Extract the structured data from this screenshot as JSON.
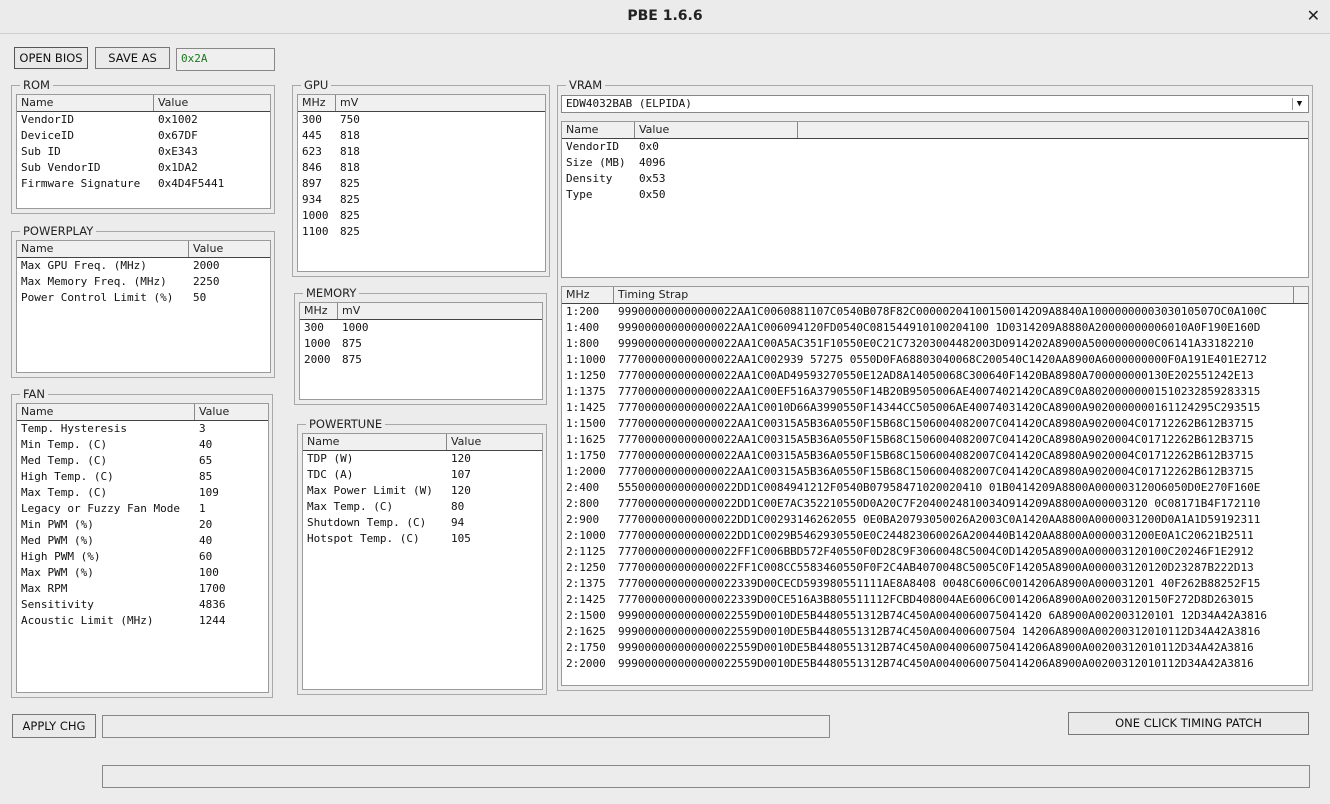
{
  "window": {
    "title": "PBE 1.6.6"
  },
  "toolbar": {
    "open_label": "OPEN BIOS",
    "save_label": "SAVE AS",
    "offset_value": "0x2A"
  },
  "rom": {
    "title": "ROM",
    "headers": [
      "Name",
      "Value"
    ],
    "rows": [
      [
        "VendorID",
        "0x1002"
      ],
      [
        "DeviceID",
        "0x67DF"
      ],
      [
        "Sub ID",
        "0xE343"
      ],
      [
        "Sub VendorID",
        "0x1DA2"
      ],
      [
        "Firmware Signature",
        "0x4D4F5441"
      ]
    ]
  },
  "powerplay": {
    "title": "POWERPLAY",
    "headers": [
      "Name",
      "Value"
    ],
    "rows": [
      [
        "Max GPU Freq. (MHz)",
        "2000"
      ],
      [
        "Max Memory Freq. (MHz)",
        "2250"
      ],
      [
        "Power Control Limit (%)",
        "50"
      ]
    ]
  },
  "fan": {
    "title": "FAN",
    "headers": [
      "Name",
      "Value"
    ],
    "rows": [
      [
        "Temp. Hysteresis",
        "3"
      ],
      [
        "Min Temp. (C)",
        "40"
      ],
      [
        "Med Temp. (C)",
        "65"
      ],
      [
        "High Temp. (C)",
        "85"
      ],
      [
        "Max Temp. (C)",
        "109"
      ],
      [
        "Legacy or Fuzzy Fan Mode",
        "1"
      ],
      [
        "Min PWM (%)",
        "20"
      ],
      [
        "Med PWM (%)",
        "40"
      ],
      [
        "High PWM (%)",
        "60"
      ],
      [
        "Max PWM (%)",
        "100"
      ],
      [
        "Max RPM",
        "1700"
      ],
      [
        "Sensitivity",
        "4836"
      ],
      [
        "Acoustic Limit (MHz)",
        "1244"
      ]
    ]
  },
  "gpu": {
    "title": "GPU",
    "headers": [
      "MHz",
      "mV"
    ],
    "rows": [
      [
        "300",
        "750"
      ],
      [
        "445",
        "818"
      ],
      [
        "623",
        "818"
      ],
      [
        "846",
        "818"
      ],
      [
        "897",
        "825"
      ],
      [
        "934",
        "825"
      ],
      [
        "1000",
        "825"
      ],
      [
        "1100",
        "825"
      ]
    ]
  },
  "memory": {
    "title": "MEMORY",
    "headers": [
      "MHz",
      "mV"
    ],
    "rows": [
      [
        "300",
        "1000"
      ],
      [
        "1000",
        "875"
      ],
      [
        "2000",
        "875"
      ]
    ]
  },
  "powertune": {
    "title": "POWERTUNE",
    "headers": [
      "Name",
      "Value"
    ],
    "rows": [
      [
        "TDP (W)",
        "120"
      ],
      [
        "TDC (A)",
        "107"
      ],
      [
        "Max Power Limit (W)",
        "120"
      ],
      [
        "Max Temp. (C)",
        "80"
      ],
      [
        "Shutdown Temp. (C)",
        "94"
      ],
      [
        "Hotspot Temp. (C)",
        "105"
      ]
    ]
  },
  "vram": {
    "title": "VRAM",
    "selected": "EDW4032BAB (ELPIDA)",
    "headers": [
      "Name",
      "Value",
      ""
    ],
    "rows": [
      [
        "VendorID",
        "0x0"
      ],
      [
        "Size (MB)",
        "4096"
      ],
      [
        "Density",
        "0x53"
      ],
      [
        "Type",
        "0x50"
      ]
    ]
  },
  "timing": {
    "headers": [
      "MHz",
      "Timing Strap"
    ],
    "rows": [
      [
        "1:200",
        "999000000000000022AA1C0060881107C0540B078F82C000002041001500142O9A8840A1000000000303010507OC0A100C"
      ],
      [
        "1:400",
        "999000000000000022AA1C006094120FD0540C081544910100204100 1D0314209A8880A20000000006010A0F190E160D"
      ],
      [
        "1:800",
        "999000000000000022AA1C00A5AC351F10550E0C21C73203004482003D0914202A8900A5000000000C06141A33182210"
      ],
      [
        "1:1000",
        "777000000000000022AA1C002939 57275 0550D0FA68803040068C200540C1420AA8900A6000000000F0A191E401E2712"
      ],
      [
        "1:1250",
        "777000000000000022AA1C00AD49593270550E12AD8A14050068C300640F1420BA8980A700000000130E202551242E13"
      ],
      [
        "1:1375",
        "777000000000000022AA1C00EF516A3790550F14B20B9505006AE40074021420CA89C0A80200000001510232859283315"
      ],
      [
        "1:1425",
        "777000000000000022AA1C0010D66A3990550F14344CC505006AE40074031420CA8900A9020000000161124295C293515"
      ],
      [
        "1:1500",
        "777000000000000022AA1C00315A5B36A0550F15B68C1506004082007C041420CA8980A9020004C01712262B612B3715"
      ],
      [
        "1:1625",
        "777000000000000022AA1C00315A5B36A0550F15B68C1506004082007C041420CA8980A9020004C01712262B612B3715"
      ],
      [
        "1:1750",
        "777000000000000022AA1C00315A5B36A0550F15B68C1506004082007C041420CA8980A9020004C01712262B612B3715"
      ],
      [
        "1:2000",
        "777000000000000022AA1C00315A5B36A0550F15B68C1506004082007C041420CA8980A9020004C01712262B612B3715"
      ],
      [
        "2:400",
        "555000000000000022DD1C0084941212F0540B07958471020020410 01B0414209A8800A000003120O6050D0E270F160E"
      ],
      [
        "2:800",
        "777000000000000022DD1C00E7AC352210550D0A20C7F2040024810034O914209A8800A000003120 0C08171B4F172110"
      ],
      [
        "2:900",
        "777000000000000022DD1C00293146262055 0E0BA20793050026A2003C0A1420AA8800A0000031200D0A1A1D59192311"
      ],
      [
        "2:1000",
        "777000000000000022DD1C0029B5462930550E0C244823060026A200440B1420AA8800A0000031200E0A1C20621B2511"
      ],
      [
        "2:1125",
        "777000000000000022FF1C006BBD572F40550F0D28C9F3060048C5004C0D14205A8900A000003120100C20246F1E2912"
      ],
      [
        "2:1250",
        "777000000000000022FF1C008CC5583460550F0F2C4AB4070048C5005C0F14205A8900A000003120120D23287B222D13"
      ],
      [
        "2:1375",
        "777000000000000022339D00CECD593980551111AE8A8408 0048C6006C0014206A8900A000031201 40F262B88252F15"
      ],
      [
        "2:1425",
        "777000000000000022339D00CE516A3B805511112FCBD408004AE6006C0014206A8900A002003120150F272D8D263015"
      ],
      [
        "2:1500",
        "999000000000000022559D0010DE5B4480551312B74C450A0040060075041420 6A8900A002003120101 12D34A42A3816"
      ],
      [
        "2:1625",
        "999000000000000022559D0010DE5B4480551312B74C450A004006007504 14206A8900A00200312010112D34A42A3816"
      ],
      [
        "2:1750",
        "999000000000000022559D0010DE5B4480551312B74C450A00400600750414206A8900A00200312010112D34A42A3816"
      ],
      [
        "2:2000",
        "999000000000000022559D0010DE5B4480551312B74C450A00400600750414206A8900A00200312010112D34A42A3816"
      ]
    ]
  },
  "bottom": {
    "apply_label": "APPLY CHG",
    "patch_label": "ONE CLICK TIMING PATCH"
  }
}
